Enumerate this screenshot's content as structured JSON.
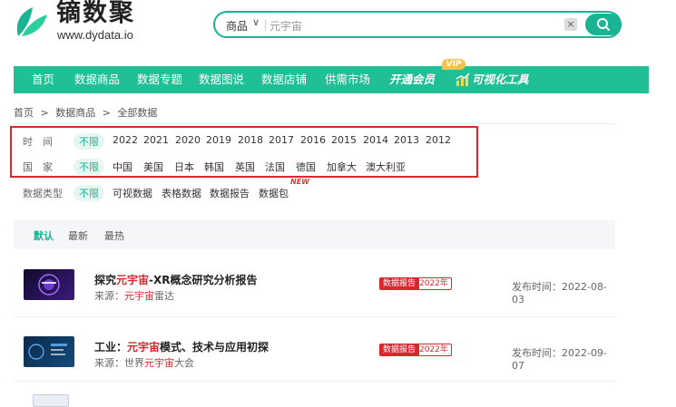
{
  "header": {
    "logo_title": "镝数聚",
    "logo_url": "www.dydata.io",
    "search": {
      "category": "商品",
      "value": "元宇宙",
      "clear_symbol": "×"
    },
    "brand_color": "#1ab394"
  },
  "nav": {
    "items": [
      "首页",
      "数据商品",
      "数据专题",
      "数据图说",
      "数据店铺",
      "供需市场"
    ],
    "vip_label": "开通会员",
    "vip_badge": "VIP",
    "tool_label": "可视化工具",
    "nav_color": "#20bf95"
  },
  "breadcrumb": [
    "首页",
    ">",
    "数据商品",
    ">",
    "全部数据"
  ],
  "filters": {
    "time": {
      "label": "时　间",
      "active": "不限",
      "options": [
        "2022",
        "2021",
        "2020",
        "2019",
        "2018",
        "2017",
        "2016",
        "2015",
        "2014",
        "2013",
        "2012"
      ]
    },
    "country": {
      "label": "国　家",
      "active": "不限",
      "options": [
        "中国",
        "美国",
        "日本",
        "韩国",
        "英国",
        "法国",
        "德国",
        "加拿大",
        "澳大利亚"
      ]
    },
    "type": {
      "label": "数据类型",
      "active": "不限",
      "options": [
        "可视数据",
        "表格数据",
        "数据报告",
        "数据包"
      ],
      "new_badge": "NEW"
    }
  },
  "sort": {
    "items": [
      "默认",
      "最新",
      "最热"
    ],
    "active": "默认"
  },
  "list": [
    {
      "title_pre": "探究",
      "title_hl": "元宇宙",
      "title_post": "-XR概念研究分析报告",
      "source_label": "来源：",
      "source_hl": "元宇宙",
      "source_post": "雷达",
      "tag_type": "数据报告",
      "tag_year": "2022年",
      "date_label": "发布时间：",
      "date": "2022-08-03"
    },
    {
      "title_pre": "工业：",
      "title_hl": "元宇宙",
      "title_post": "模式、技术与应用初探",
      "source_label": "来源：",
      "source_pre": "世界",
      "source_hl": "元宇宙",
      "source_post": "大会",
      "tag_type": "数据报告",
      "tag_year": "2022年",
      "date_label": "发布时间：",
      "date": "2022-09-07"
    }
  ]
}
